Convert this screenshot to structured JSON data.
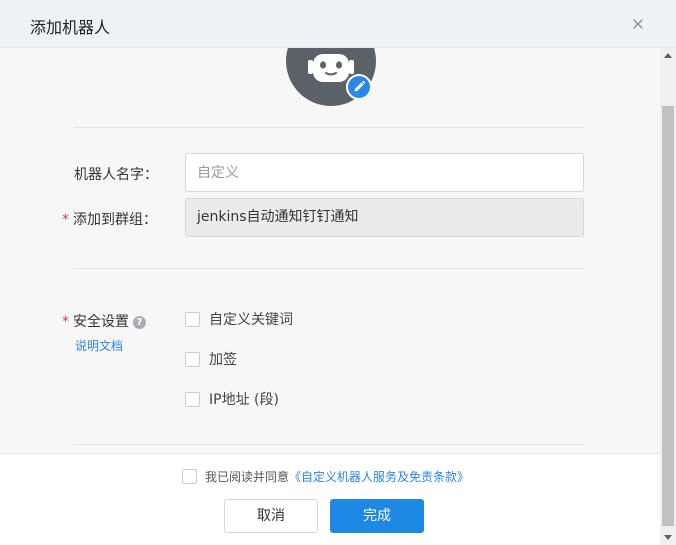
{
  "header": {
    "title": "添加机器人"
  },
  "form": {
    "name_label": "机器人名字：",
    "name_placeholder": "自定义",
    "group_label": "添加到群组：",
    "group_value": "jenkins自动通知钉钉通知",
    "required_mark": "*"
  },
  "security": {
    "label": "安全设置",
    "help_glyph": "?",
    "doc_link": "说明文档",
    "options": [
      {
        "label": "自定义关键词"
      },
      {
        "label": "加签"
      },
      {
        "label": "IP地址 (段)"
      }
    ]
  },
  "footer": {
    "agree_text": "我已阅读并同意",
    "terms_link": "《自定义机器人服务及免责条款》",
    "cancel_label": "取消",
    "done_label": "完成"
  },
  "colors": {
    "accent": "#1e88e5",
    "required": "#e23c3c",
    "avatar": "#5b6168"
  }
}
